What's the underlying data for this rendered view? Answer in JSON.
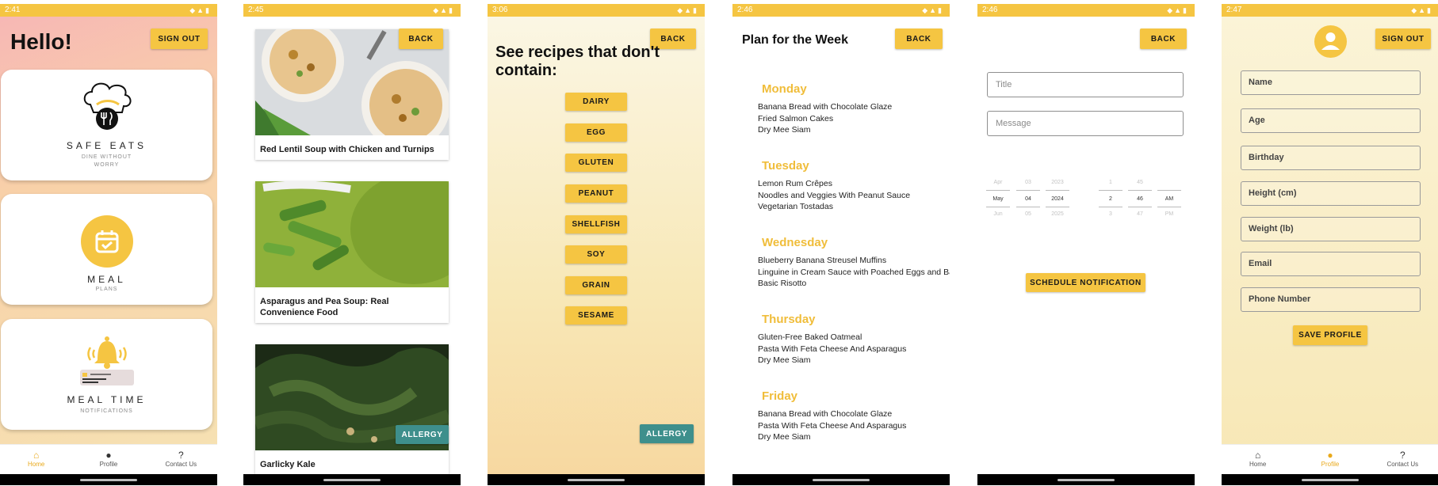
{
  "screen1": {
    "time": "2:41",
    "greeting": "Hello!",
    "signout_label": "SIGN OUT",
    "card1": {
      "title": "SAFE EATS",
      "sub1": "DINE WITHOUT",
      "sub2": "WORRY",
      "icon": "chef-hat-logo"
    },
    "card2": {
      "title": "MEAL",
      "sub": "PLANS",
      "icon": "calendar-check-icon"
    },
    "card3": {
      "title": "MEAL TIME",
      "sub": "NOTIFICATIONS",
      "icon": "bell-icon"
    },
    "nav": [
      {
        "label": "Home",
        "icon": "home-icon",
        "active": true
      },
      {
        "label": "Profile",
        "icon": "profile-icon",
        "active": false
      },
      {
        "label": "Contact Us",
        "icon": "help-icon",
        "active": false
      }
    ]
  },
  "screen2": {
    "time": "2:45",
    "back_label": "BACK",
    "allergy_label": "ALLERGY",
    "recipes": [
      {
        "title": "Red Lentil Soup with Chicken and Turnips"
      },
      {
        "title": "Asparagus and Pea Soup: Real Convenience Food"
      },
      {
        "title": "Garlicky Kale"
      }
    ]
  },
  "screen3": {
    "time": "3:06",
    "back_label": "BACK",
    "heading": "See recipes that don't contain:",
    "allergens": [
      "DAIRY",
      "EGG",
      "GLUTEN",
      "PEANUT",
      "SHELLFISH",
      "SOY",
      "GRAIN",
      "SESAME"
    ],
    "allergy_label": "ALLERGY"
  },
  "screen4": {
    "time": "2:46",
    "title": "Plan for the Week",
    "back_label": "BACK",
    "days": [
      {
        "name": "Monday",
        "meals": [
          "Banana Bread with Chocolate Glaze",
          "Fried Salmon Cakes",
          "Dry Mee Siam"
        ]
      },
      {
        "name": "Tuesday",
        "meals": [
          "Lemon Rum Crêpes",
          "Noodles and Veggies With Peanut Sauce",
          "Vegetarian Tostadas"
        ]
      },
      {
        "name": "Wednesday",
        "meals": [
          "Blueberry Banana Streusel Muffins",
          "Linguine in Cream Sauce with Poached Eggs and Ba",
          "Basic Risotto"
        ]
      },
      {
        "name": "Thursday",
        "meals": [
          "Gluten-Free Baked Oatmeal",
          "Pasta With Feta Cheese And Asparagus",
          "Dry Mee Siam"
        ]
      },
      {
        "name": "Friday",
        "meals": [
          "Banana Bread with Chocolate Glaze",
          "Pasta With Feta Cheese And Asparagus",
          "Dry Mee Siam"
        ]
      }
    ]
  },
  "screen5": {
    "time": "2:46",
    "back_label": "BACK",
    "title_placeholder": "Title",
    "message_placeholder": "Message",
    "date_picker": {
      "month": {
        "prev": "Apr",
        "sel": "May",
        "next": "Jun"
      },
      "day": {
        "prev": "03",
        "sel": "04",
        "next": "05"
      },
      "year": {
        "prev": "2023",
        "sel": "2024",
        "next": "2025"
      }
    },
    "time_picker": {
      "hour": {
        "prev": "1",
        "sel": "2",
        "next": "3"
      },
      "minute": {
        "prev": "45",
        "sel": "46",
        "next": "47"
      },
      "ampm": {
        "prev": "",
        "sel": "AM",
        "next": "PM"
      }
    },
    "schedule_label": "SCHEDULE NOTIFICATION"
  },
  "screen6": {
    "time": "2:47",
    "signout_label": "SIGN OUT",
    "fields": [
      "Name",
      "Age",
      "Birthday",
      "Height (cm)",
      "Weight (lb)",
      "Email",
      "Phone Number"
    ],
    "save_label": "SAVE PROFILE",
    "nav": [
      {
        "label": "Home",
        "icon": "home-icon",
        "active": false
      },
      {
        "label": "Profile",
        "icon": "profile-icon",
        "active": true
      },
      {
        "label": "Contact Us",
        "icon": "help-icon",
        "active": false
      }
    ]
  },
  "colors": {
    "accent": "#f5c542",
    "teal": "#3e8f8c",
    "day_heading": "#f0bd3a",
    "nav_active": "#e9a91b"
  }
}
